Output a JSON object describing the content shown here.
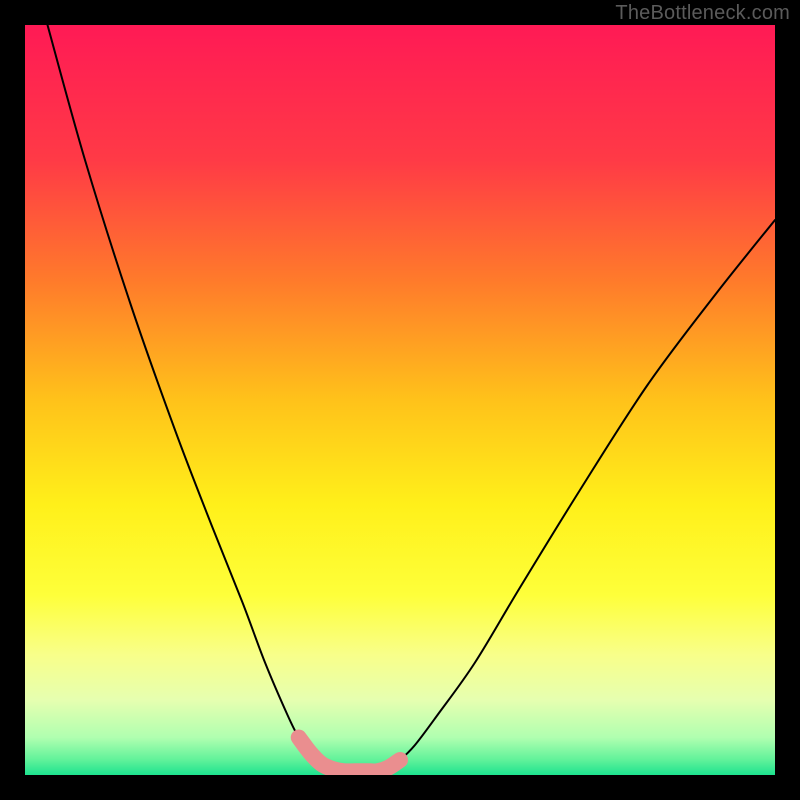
{
  "watermark": "TheBottleneck.com",
  "chart_data": {
    "type": "line",
    "title": "",
    "xlabel": "",
    "ylabel": "",
    "xlim": [
      0,
      100
    ],
    "ylim": [
      0,
      100
    ],
    "grid": false,
    "legend": false,
    "series": [
      {
        "name": "bottleneck-curve-left",
        "x": [
          3,
          8,
          14,
          20,
          25,
          29,
          32,
          35,
          36.5,
          38,
          39.5,
          41,
          42.5
        ],
        "values": [
          100,
          82,
          63,
          46,
          33,
          23,
          15,
          8,
          5,
          3,
          1.5,
          0.8,
          0.5
        ],
        "color": "#000000"
      },
      {
        "name": "bottleneck-curve-right",
        "x": [
          47,
          48.5,
          50,
          52,
          55,
          60,
          66,
          74,
          83,
          92,
          100
        ],
        "values": [
          0.5,
          1,
          2,
          4,
          8,
          15,
          25,
          38,
          52,
          64,
          74
        ],
        "color": "#000000"
      },
      {
        "name": "optimal-highlight",
        "x": [
          36.5,
          38,
          39.5,
          41,
          42.5,
          44,
          46,
          47,
          48.5,
          50
        ],
        "values": [
          5,
          3,
          1.5,
          0.8,
          0.5,
          0.5,
          0.5,
          0.5,
          1,
          2
        ],
        "color": "#ea8e8f"
      }
    ],
    "background_gradient": {
      "stops": [
        {
          "pct": 0,
          "color": "#ff1a55"
        },
        {
          "pct": 18,
          "color": "#ff3a46"
        },
        {
          "pct": 34,
          "color": "#ff7a2b"
        },
        {
          "pct": 50,
          "color": "#ffc21a"
        },
        {
          "pct": 64,
          "color": "#fff01a"
        },
        {
          "pct": 76,
          "color": "#feff3a"
        },
        {
          "pct": 84,
          "color": "#f8ff8a"
        },
        {
          "pct": 90,
          "color": "#e6ffb0"
        },
        {
          "pct": 95,
          "color": "#b0ffb0"
        },
        {
          "pct": 98,
          "color": "#60f29a"
        },
        {
          "pct": 100,
          "color": "#1de38f"
        }
      ]
    }
  }
}
